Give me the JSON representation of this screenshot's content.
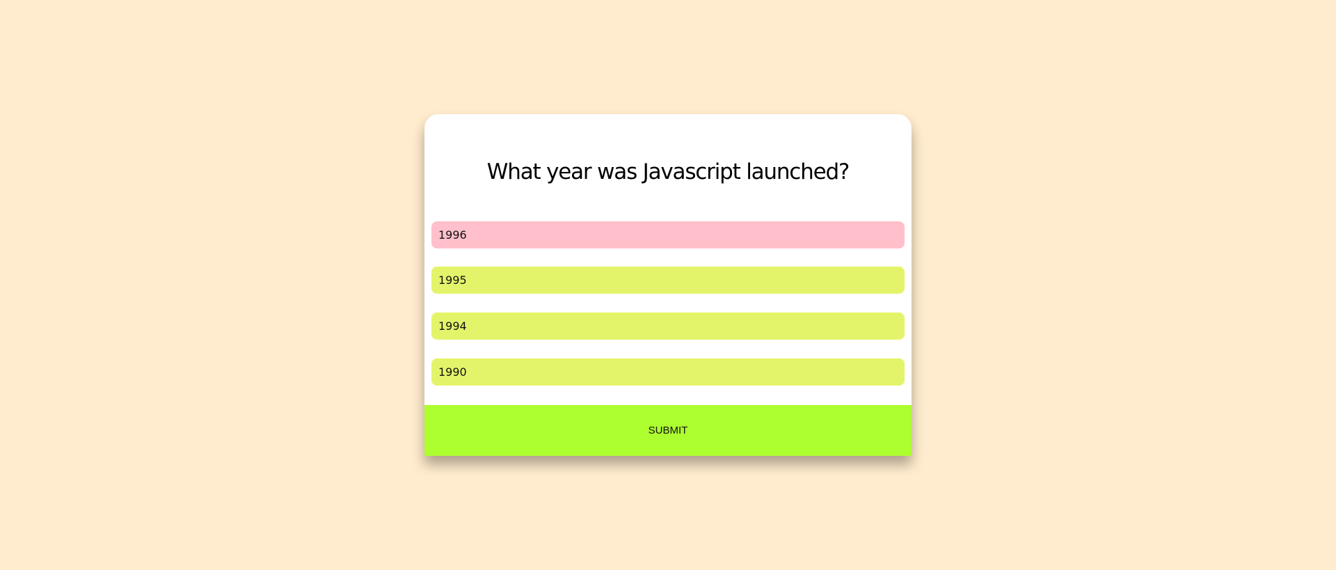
{
  "quiz": {
    "question": "What year was Javascript launched?",
    "answers": [
      {
        "label": "1996",
        "selected": true
      },
      {
        "label": "1995",
        "selected": false
      },
      {
        "label": "1994",
        "selected": false
      },
      {
        "label": "1990",
        "selected": false
      }
    ],
    "submit_label": "SUBMIT"
  },
  "colors": {
    "page_background": "#ffebcd",
    "card_background": "#ffffff",
    "answer_selected": "#ffc0cb",
    "answer_default": "#e4f46a",
    "submit_button": "#adff2f"
  }
}
